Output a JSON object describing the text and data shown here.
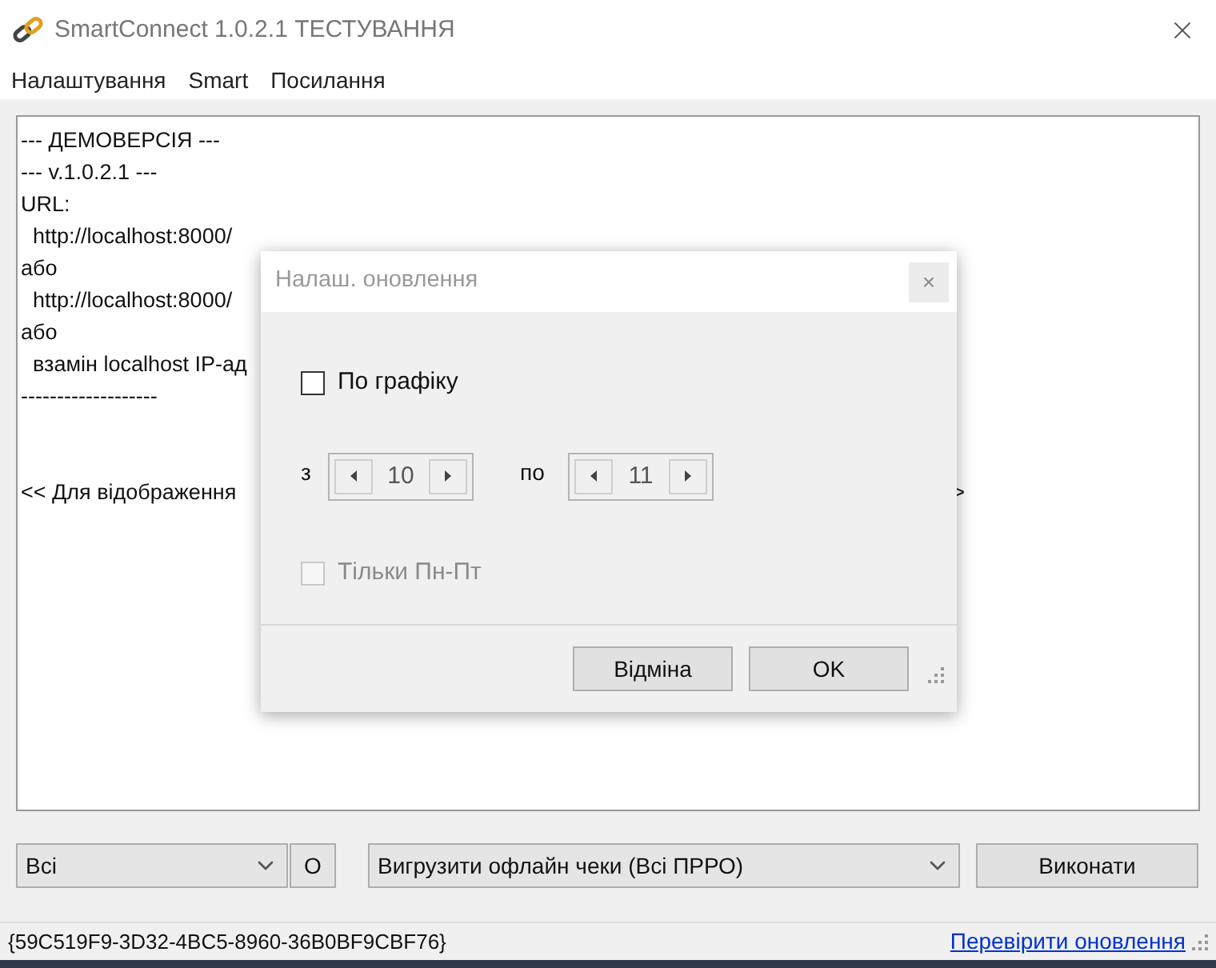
{
  "window": {
    "title": "SmartConnect 1.0.2.1 ТЕСТУВАННЯ"
  },
  "menu": [
    "Налаштування",
    "Smart",
    "Посилання"
  ],
  "log": {
    "lines": [
      "--- ДЕМОВЕРСІЯ ---",
      "--- v.1.0.2.1 ---",
      "URL:",
      "  http://localhost:8000/",
      "або",
      "  http://localhost:8000/",
      "або",
      "  взамін localhost IP-ад",
      "-------------------"
    ],
    "hint": {
      "text": "<< Для відображення",
      "right_fragment": ">"
    }
  },
  "dialog": {
    "title": "Налаш. оновлення",
    "close": "×",
    "schedule": {
      "label": "По графіку",
      "checked": false,
      "disabled": false
    },
    "from": {
      "label": "з",
      "value": "10"
    },
    "to": {
      "label": "по",
      "value": "11"
    },
    "weekdays": {
      "label": "Тільки Пн-Пт",
      "checked": false,
      "disabled": true
    },
    "buttons": [
      "Відміна",
      "OK"
    ]
  },
  "controls": {
    "filter": "Всі",
    "o_button": "O",
    "action": "Вигрузити офлайн чеки (Всі ПРРО)",
    "run_button": "Виконати"
  },
  "status_bar": {
    "id": "{59C519F9-3D32-4BC5-8960-36B0BF9CBF76}",
    "link": "Перевірити оновлення"
  }
}
